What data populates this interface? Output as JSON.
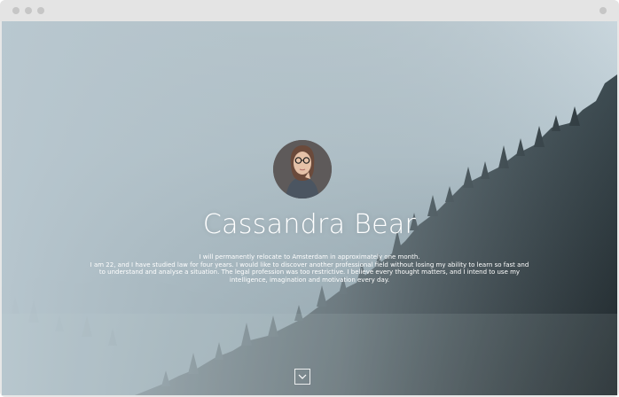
{
  "browser": {
    "controls": [
      "close-dot",
      "minimize-dot",
      "maximize-dot"
    ]
  },
  "hero": {
    "name": "Cassandra Bear",
    "bio": [
      "I will permanently relocate to Amsterdam in approximately one month.",
      "I am 22, and I have studied law for four years. I would like to discover another professional field without losing my ability to learn so fast and",
      "to understand and analyse a situation. The legal profession was too restrictive. I believe every thought matters, and I intend to use my",
      "intelligence, imagination and motivation every day."
    ],
    "scroll_icon": "chevron-down-icon"
  },
  "colors": {
    "sky": "#c9d6dd",
    "forest": "#2f3a40",
    "text": "#ffffff",
    "chrome": "#e4e4e4"
  }
}
